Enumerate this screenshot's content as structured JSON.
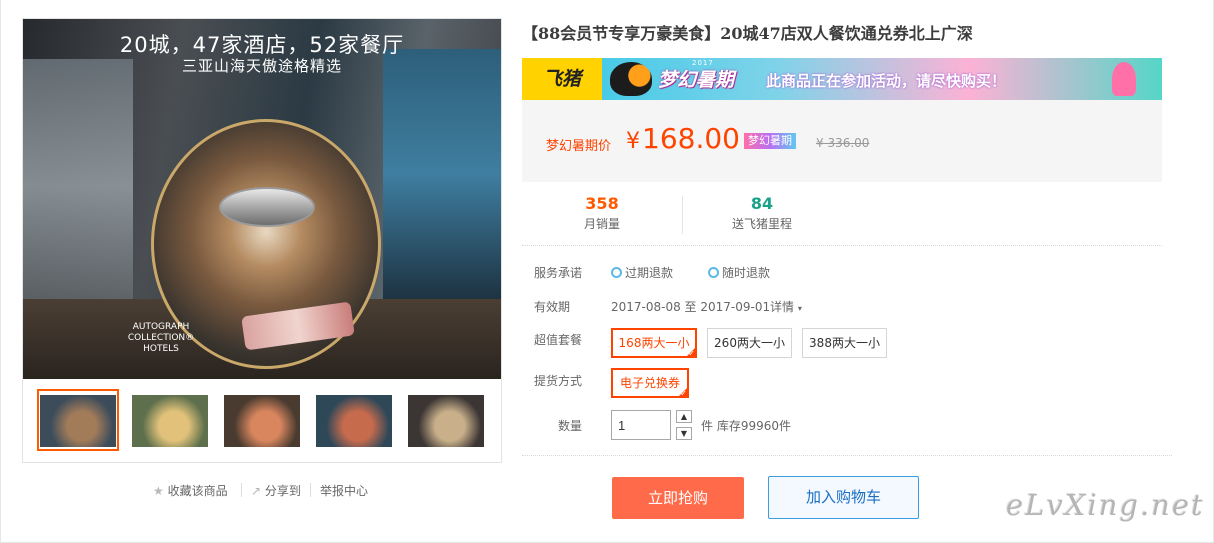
{
  "gallery": {
    "main_caption_line1": "20城，47家酒店，52家餐厅",
    "main_caption_line2": "三亚山海天傲途格精选",
    "brand_text": "AUTOGRAPH COLLECTION® HOTELS",
    "thumbnails": [
      {
        "selected": true,
        "colors": [
          "#3c4c5a",
          "#a27b59"
        ]
      },
      {
        "selected": false,
        "colors": [
          "#5d6f4c",
          "#e2c27a"
        ]
      },
      {
        "selected": false,
        "colors": [
          "#4a3b30",
          "#d9865e"
        ]
      },
      {
        "selected": false,
        "colors": [
          "#2f4858",
          "#c76b4d"
        ]
      },
      {
        "selected": false,
        "colors": [
          "#3b3534",
          "#c9b08a"
        ]
      }
    ]
  },
  "actions": {
    "favorite": "收藏该商品",
    "share": "分享到",
    "report": "举报中心"
  },
  "product": {
    "title": "【88会员节专享万豪美食】20城47店双人餐饮通兑券北上广深"
  },
  "banner": {
    "brand": "飞猪",
    "campaign": "梦幻暑期",
    "year": "2017",
    "message": "此商品正在参加活动，请尽快购买！"
  },
  "price": {
    "label": "梦幻暑期价",
    "currency": "¥",
    "value": "168.00",
    "badge": "梦幻暑期",
    "original": "¥ 336.00"
  },
  "stats": {
    "monthly_sales": {
      "value": "358",
      "label": "月销量",
      "color": "#ff5a00"
    },
    "miles": {
      "value": "84",
      "label": "送飞猪里程",
      "color": "#1aa189"
    }
  },
  "service": {
    "label": "服务承诺",
    "items": [
      "过期退款",
      "随时退款"
    ]
  },
  "validity": {
    "label": "有效期",
    "value": "2017-08-08 至 2017-09-01",
    "detail": "详情"
  },
  "package": {
    "label": "超值套餐",
    "options": [
      "168两大一小",
      "260两大一小",
      "388两大一小"
    ],
    "selected": "168两大一小"
  },
  "delivery": {
    "label": "提货方式",
    "options": [
      "电子兑换券"
    ],
    "selected": "电子兑换券"
  },
  "quantity": {
    "label": "数量",
    "value": "1",
    "unit": "件",
    "stock": "库存99960件"
  },
  "buttons": {
    "buy": "立即抢购",
    "cart": "加入购物车"
  },
  "watermark": "eLvXing.net",
  "colors": {
    "accent": "#ff4400",
    "buy_button": "#ff6b4a",
    "cart_border": "#3b9de0",
    "price_bg": "#f5f5f5"
  }
}
